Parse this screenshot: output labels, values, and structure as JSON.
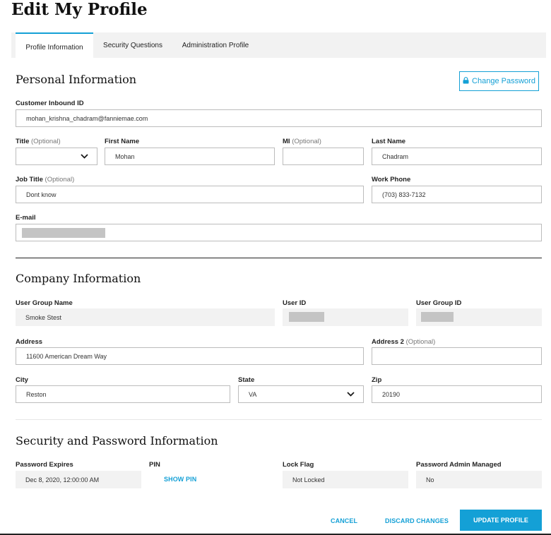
{
  "page": {
    "title": "Edit My Profile"
  },
  "tabs": [
    {
      "label": "Profile Information",
      "active": true
    },
    {
      "label": "Security Questions",
      "active": false
    },
    {
      "label": "Administration Profile",
      "active": false
    }
  ],
  "personal": {
    "heading": "Personal Information",
    "change_password_label": "Change Password",
    "inbound_id": {
      "label": "Customer Inbound ID",
      "value": "mohan_krishna_chadram@fanniemae.com"
    },
    "title": {
      "label": "Title",
      "optional": "(Optional)",
      "value": ""
    },
    "first_name": {
      "label": "First Name",
      "value": "Mohan"
    },
    "mi": {
      "label": "MI",
      "optional": "(Optional)",
      "value": ""
    },
    "last_name": {
      "label": "Last Name",
      "value": "Chadram"
    },
    "job_title": {
      "label": "Job Title",
      "optional": "(Optional)",
      "value": "Dont know"
    },
    "work_phone": {
      "label": "Work Phone",
      "value": "(703) 833-7132"
    },
    "email": {
      "label": "E-mail"
    }
  },
  "company": {
    "heading": "Company Information",
    "user_group_name": {
      "label": "User Group Name",
      "value": "Smoke Stest"
    },
    "user_id": {
      "label": "User ID"
    },
    "user_group_id": {
      "label": "User Group ID"
    },
    "address": {
      "label": "Address",
      "value": "11600 American Dream Way"
    },
    "address2": {
      "label": "Address 2",
      "optional": "(Optional)",
      "value": ""
    },
    "city": {
      "label": "City",
      "value": "Reston"
    },
    "state": {
      "label": "State",
      "value": "VA"
    },
    "zip": {
      "label": "Zip",
      "value": "20190"
    }
  },
  "security": {
    "heading": "Security and Password Information",
    "password_expires": {
      "label": "Password Expires",
      "value": "Dec 8, 2020, 12:00:00 AM"
    },
    "pin": {
      "label": "PIN",
      "link": "SHOW PIN"
    },
    "lock_flag": {
      "label": "Lock Flag",
      "value": "Not Locked"
    },
    "admin_managed": {
      "label": "Password Admin Managed",
      "value": "No"
    }
  },
  "actions": {
    "cancel": "CANCEL",
    "discard": "DISCARD CHANGES",
    "update": "UPDATE PROFILE"
  },
  "icons": {
    "lock": "lock-icon",
    "chevron": "chevron-down-icon"
  },
  "colors": {
    "accent": "#14a0d6",
    "readonly_bg": "#f2f2f2",
    "redaction": "#c4c4c4"
  }
}
